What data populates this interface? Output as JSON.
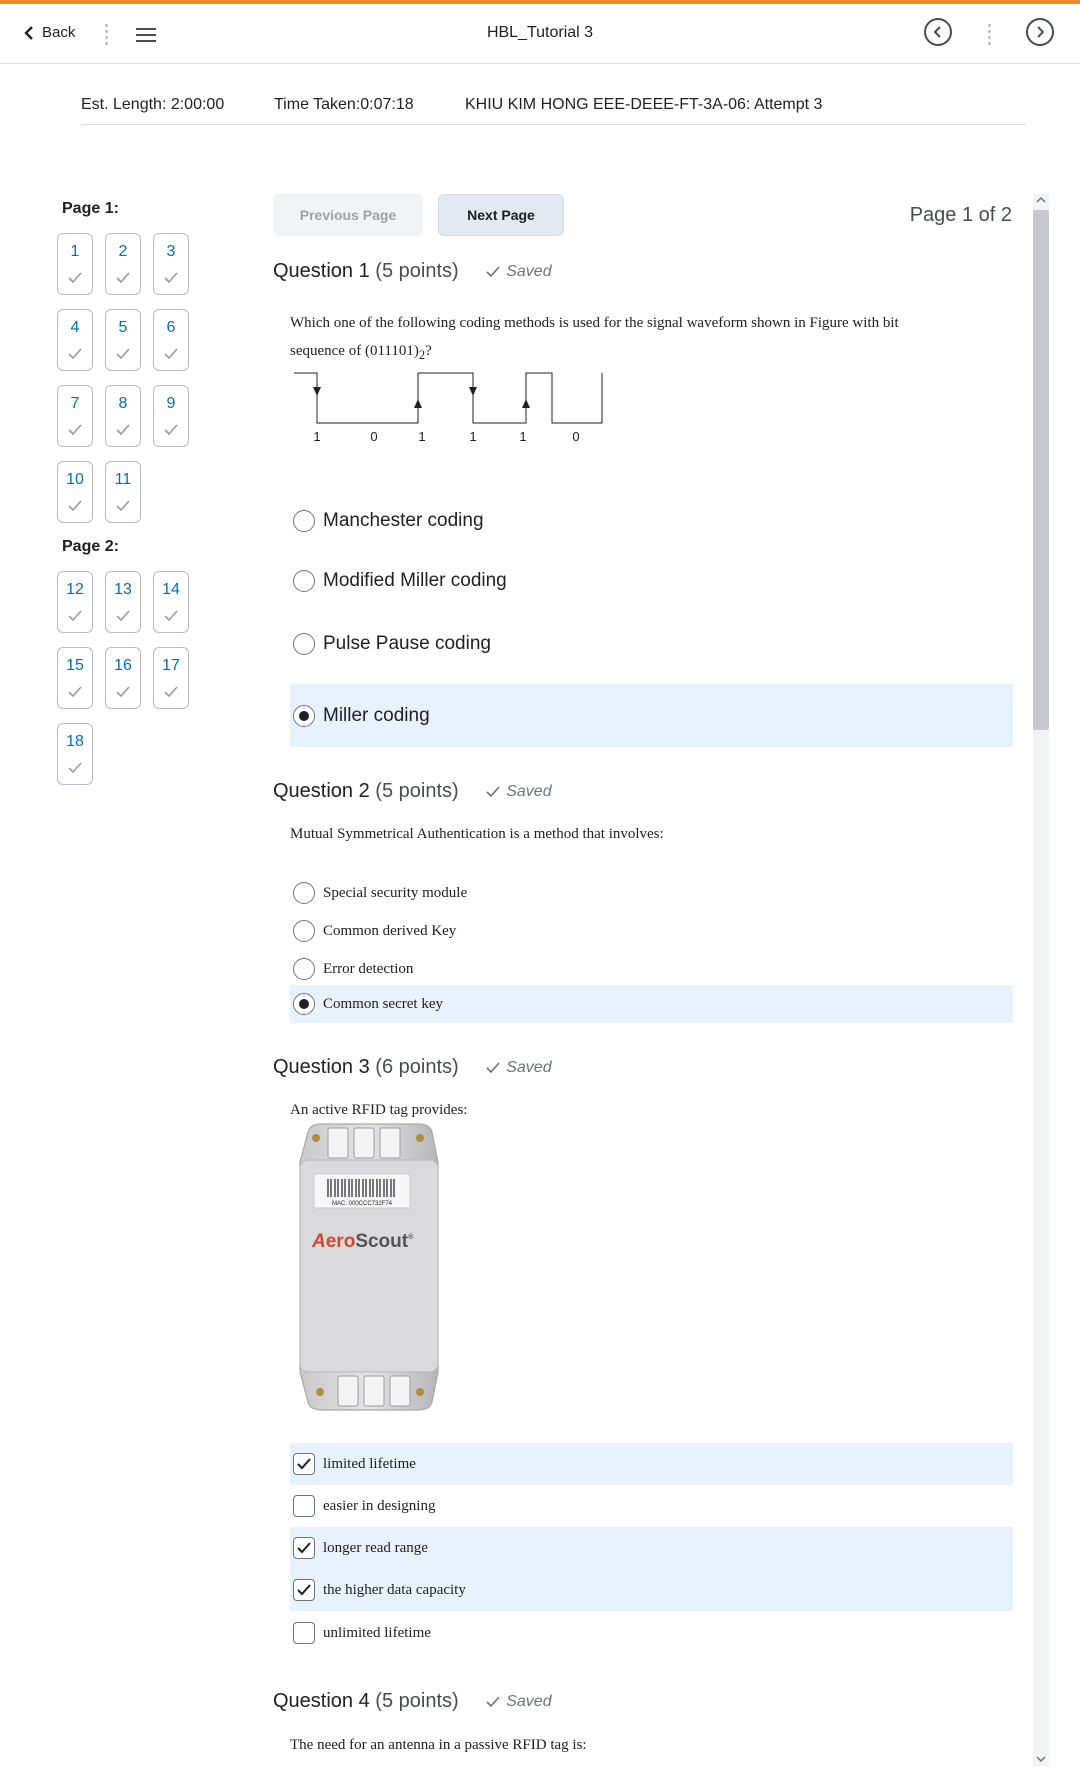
{
  "header": {
    "back_label": "Back",
    "title": "HBL_Tutorial 3"
  },
  "info": {
    "est_length": "Est. Length: 2:00:00",
    "time_taken": "Time Taken:0:07:18",
    "attempt": "KHIU KIM HONG EEE-DEEE-FT-3A-06: Attempt 3"
  },
  "nav": {
    "page1_label": "Page 1:",
    "page2_label": "Page 2:",
    "page1_questions": [
      "1",
      "2",
      "3",
      "4",
      "5",
      "6",
      "7",
      "8",
      "9",
      "10",
      "11"
    ],
    "page2_questions": [
      "12",
      "13",
      "14",
      "15",
      "16",
      "17",
      "18"
    ]
  },
  "paging": {
    "prev_label": "Previous Page",
    "next_label": "Next Page",
    "page_indicator": "Page 1 of 2"
  },
  "saved_label": "Saved",
  "questions": [
    {
      "title": "Question 1",
      "points": "(5 points)",
      "text_part1": "Which one of the following coding methods is used for the signal waveform shown in Figure with bit",
      "text_part2_prefix": "sequence of (011101)",
      "text_part2_sub": "2",
      "text_part2_suffix": "?",
      "waveform_bits": [
        "1",
        "0",
        "1",
        "1",
        "1",
        "0"
      ],
      "options": [
        "Manchester coding",
        "Modified Miller coding",
        "Pulse Pause coding",
        "Miller coding"
      ],
      "selected": 3
    },
    {
      "title": "Question 2",
      "points": "(5 points)",
      "text": "Mutual Symmetrical Authentication is a method that involves:",
      "options": [
        "Special security module",
        "Common derived Key",
        "Error detection",
        "Common secret key"
      ],
      "selected": 3
    },
    {
      "title": "Question 3",
      "points": "(6 points)",
      "text": "An active RFID tag provides:",
      "image": {
        "mac_label": "MAC: 000CCC732F74",
        "brand_prefix": "A",
        "brand_mid": "ero",
        "brand_suffix": "Scout",
        "brand_mark": "®"
      },
      "options": [
        "limited lifetime",
        "easier in designing",
        "longer read range",
        "the higher data capacity",
        "unlimited lifetime"
      ],
      "checked": [
        true,
        false,
        true,
        true,
        false
      ]
    },
    {
      "title": "Question 4",
      "points": "(5 points)",
      "text": "The need for an antenna in a passive RFID tag is:"
    }
  ],
  "colors": {
    "accent": "#f08a24",
    "link": "#006fbf",
    "selected_bg": "#e8f2fd"
  }
}
